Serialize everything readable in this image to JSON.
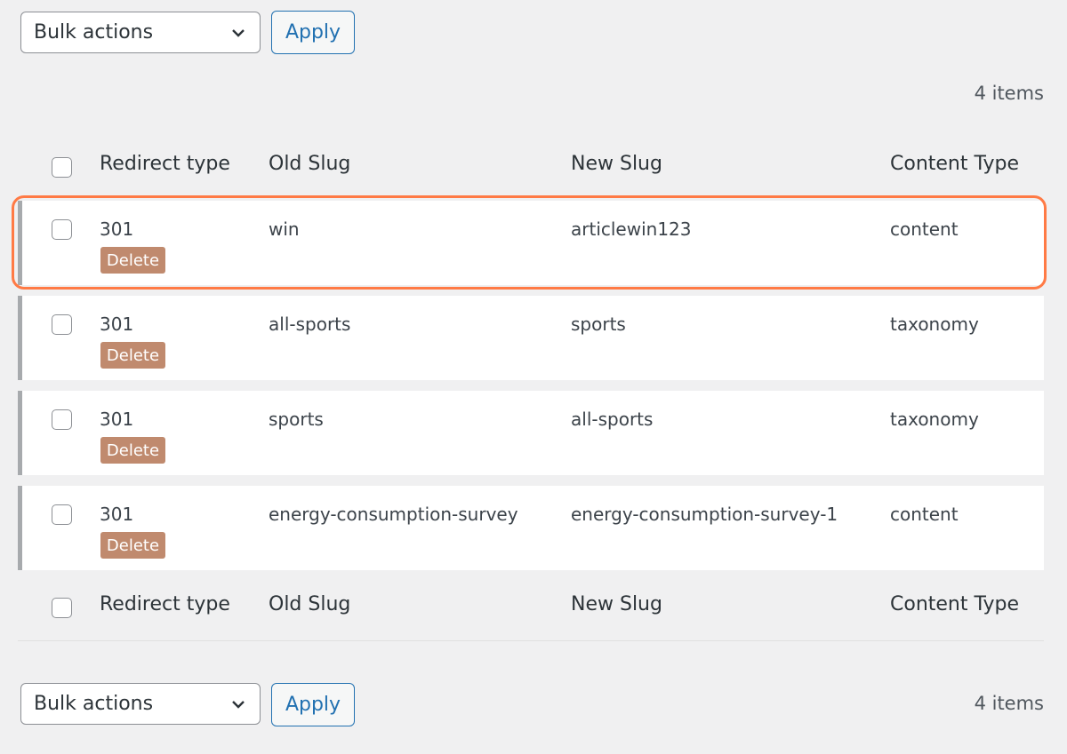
{
  "top_bar": {
    "bulk_select_value": "Bulk actions",
    "apply_label": "Apply",
    "items_count": "4 items"
  },
  "header": {
    "redirect_type": "Redirect type",
    "old_slug": "Old Slug",
    "new_slug": "New Slug",
    "content_type": "Content Type"
  },
  "rows": [
    {
      "redirect_type": "301",
      "delete_label": "Delete",
      "old_slug": "win",
      "new_slug": "articlewin123",
      "content_type": "content"
    },
    {
      "redirect_type": "301",
      "delete_label": "Delete",
      "old_slug": "all-sports",
      "new_slug": "sports",
      "content_type": "taxonomy"
    },
    {
      "redirect_type": "301",
      "delete_label": "Delete",
      "old_slug": "sports",
      "new_slug": "all-sports",
      "content_type": "taxonomy"
    },
    {
      "redirect_type": "301",
      "delete_label": "Delete",
      "old_slug": "energy-consumption-survey",
      "new_slug": "energy-consumption-survey-1",
      "content_type": "content"
    }
  ],
  "footer": {
    "redirect_type": "Redirect type",
    "old_slug": "Old Slug",
    "new_slug": "New Slug",
    "content_type": "Content Type"
  },
  "bottom_bar": {
    "bulk_select_value": "Bulk actions",
    "apply_label": "Apply",
    "items_count": "4 items"
  },
  "colors": {
    "accent": "#2271b1",
    "delete_badge": "#c08a6e",
    "highlight": "#ff7a45"
  },
  "icons": {
    "dropdown": "chevron-down-icon"
  }
}
